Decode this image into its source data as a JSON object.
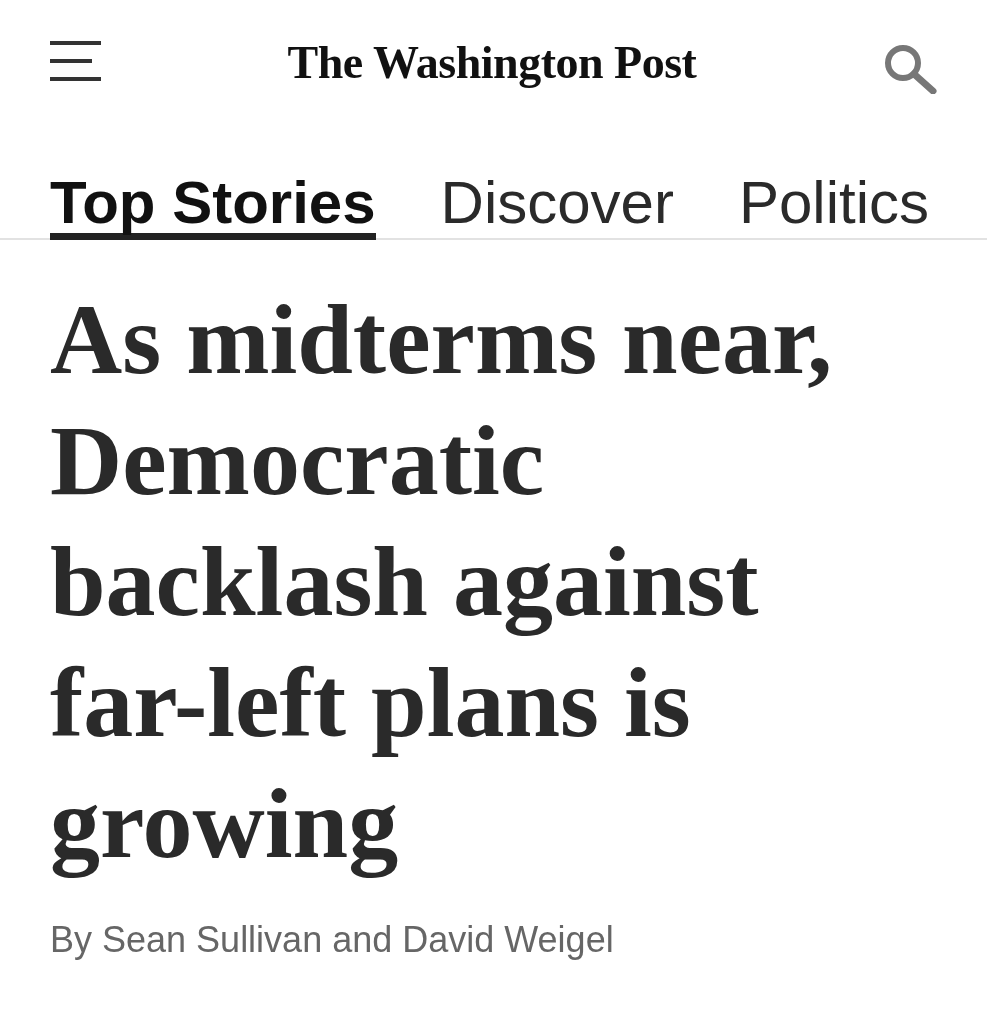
{
  "header": {
    "logo": "The Washington Post"
  },
  "tabs": [
    {
      "label": "Top Stories",
      "selected": true
    },
    {
      "label": "Discover",
      "selected": false
    },
    {
      "label": "Politics",
      "selected": false
    }
  ],
  "article": {
    "headline": "As midterms near, Democratic backlash against far-left plans is growing",
    "byline": "By Sean Sullivan and David Weigel"
  }
}
